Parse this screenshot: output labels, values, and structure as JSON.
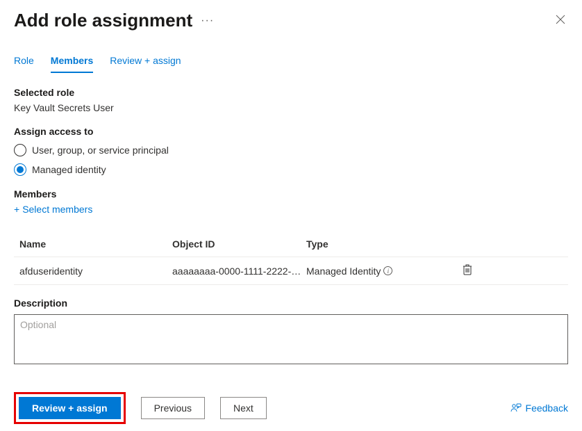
{
  "header": {
    "title": "Add role assignment"
  },
  "tabs": {
    "role": "Role",
    "members": "Members",
    "review": "Review + assign"
  },
  "selectedRole": {
    "label": "Selected role",
    "value": "Key Vault Secrets User"
  },
  "assignAccess": {
    "label": "Assign access to",
    "option1": "User, group, or service principal",
    "option2": "Managed identity"
  },
  "members": {
    "label": "Members",
    "selectLink": "Select members",
    "columns": {
      "name": "Name",
      "objectId": "Object ID",
      "type": "Type"
    },
    "rows": [
      {
        "name": "afduseridentity",
        "objectId": "aaaaaaaa-0000-1111-2222-bb...",
        "type": "Managed Identity"
      }
    ]
  },
  "description": {
    "label": "Description",
    "placeholder": "Optional"
  },
  "footer": {
    "reviewAssign": "Review + assign",
    "previous": "Previous",
    "next": "Next",
    "feedback": "Feedback"
  }
}
